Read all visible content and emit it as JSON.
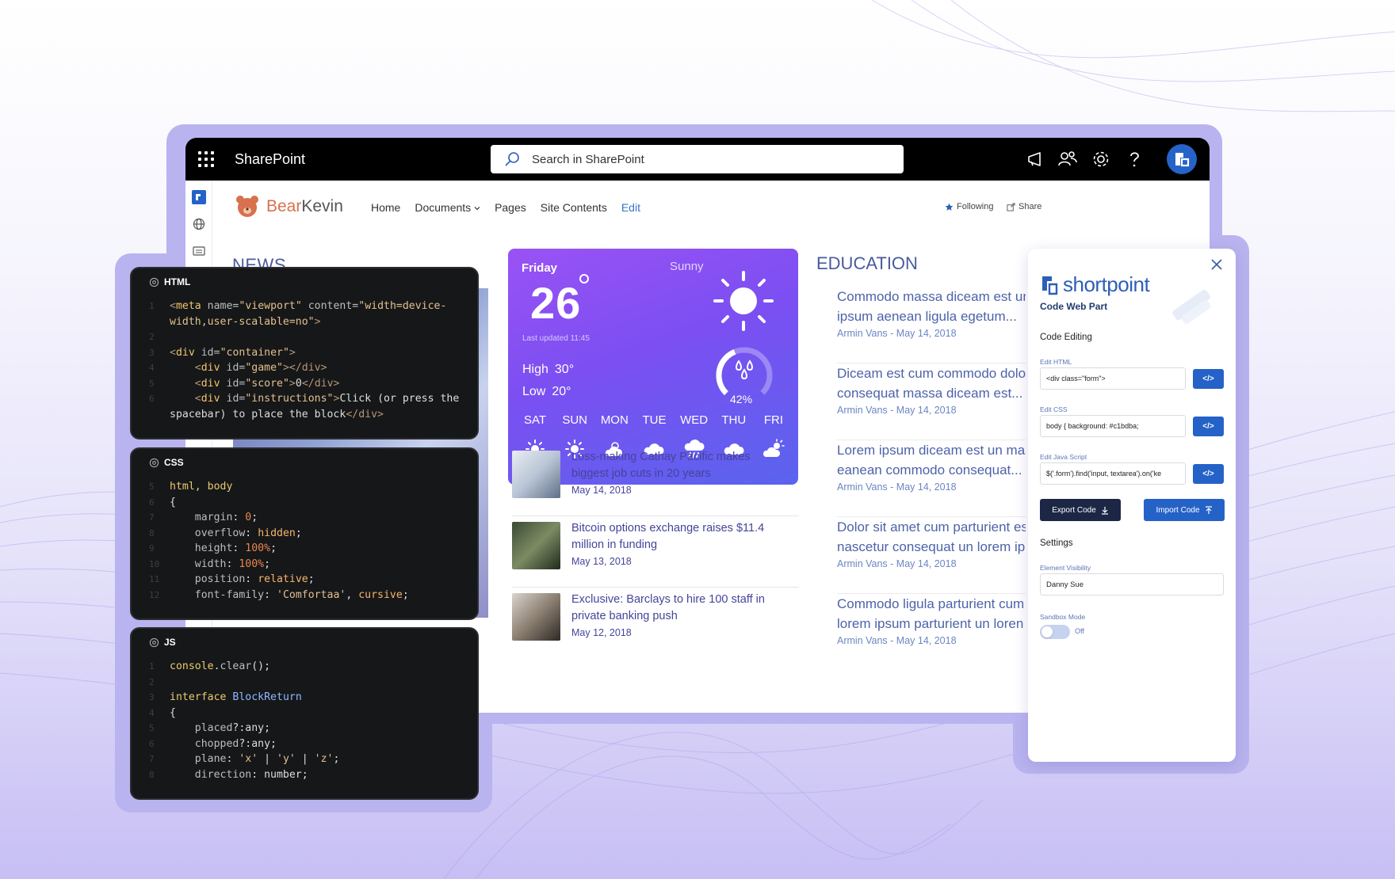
{
  "colors": {
    "accent": "#2562c7",
    "topbar": "#000000",
    "weather_start": "#9a52f4",
    "weather_end": "#5a64ee",
    "code_bg": "#161719",
    "frame": "#b9b3ef"
  },
  "sharepoint": {
    "app_name": "SharePoint",
    "search_placeholder": "Search in SharePoint",
    "icons": [
      "waffle-icon",
      "megaphone-icon",
      "people-icon",
      "gear-icon",
      "help-icon",
      "avatar-icon"
    ]
  },
  "site": {
    "name_part1": "Bear",
    "name_part2": "Kevin",
    "nav": [
      "Home",
      "Documents",
      "Pages",
      "Site Contents",
      "Edit"
    ],
    "following": "Following",
    "share": "Share"
  },
  "news": {
    "title": "NEWS",
    "partial_date": "May 13, 2018"
  },
  "weather": {
    "day": "Friday",
    "condition": "Sunny",
    "temp": "26",
    "last_updated": "Last updated 11:45",
    "high_label": "High",
    "high": "30°",
    "low_label": "Low",
    "low": "20°",
    "humidity": "42%",
    "humidity_fraction": 0.42,
    "days": [
      "SAT",
      "SUN",
      "MON",
      "TUE",
      "WED",
      "THU",
      "FRI"
    ],
    "day_icons": [
      "sun-icon",
      "sun-icon",
      "partly-cloudy-icon",
      "cloud-icon",
      "rain-icon",
      "cloud-icon",
      "partly-sunny-icon"
    ]
  },
  "articles": [
    {
      "title": "Loss-making Cathay Pacific makes biggest job cuts in 20 years",
      "date": "May 14, 2018"
    },
    {
      "title": "Bitcoin options exchange raises $11.4 million in funding",
      "date": "May 13, 2018"
    },
    {
      "title": "Exclusive: Barclays to hire 100 staff in private banking push",
      "date": "May 12, 2018"
    }
  ],
  "education": {
    "title": "EDUCATION",
    "items": [
      {
        "line1": "Commodo massa diceam est un",
        "line2": "ipsum aenean ligula egetum...",
        "meta": "Armin Vans - May 14, 2018"
      },
      {
        "line1": "Diceam est cum commodo dolo",
        "line2": "consequat massa diceam est...",
        "meta": "Armin Vans - May 14, 2018"
      },
      {
        "line1": "Lorem ipsum diceam est un mas",
        "line2": "eanean commodo consequat...",
        "meta": "Armin Vans - May 14, 2018"
      },
      {
        "line1": "Dolor sit amet cum parturient es",
        "line2": "nascetur consequat un lorem ip",
        "meta": "Armin Vans - May 14, 2018"
      },
      {
        "line1": "Commodo ligula parturient cum",
        "line2": "lorem ipsum parturient un loren",
        "meta": "Armin Vans - May 14, 2018"
      }
    ]
  },
  "code_html": {
    "label": "HTML"
  },
  "code_css": {
    "label": "CSS"
  },
  "code_js": {
    "label": "JS"
  },
  "panel": {
    "brand": "shortpoint",
    "subtitle": "Code Web Part",
    "section_code": "Code Editing",
    "html_label": "Edit HTML",
    "html_value": "<div class=\"form\">",
    "css_label": "Edit CSS",
    "css_value": "body {    background: #c1bdba;",
    "js_label": "Edit Java Script",
    "js_value": "$('.form').find('input, textarea').on('ke",
    "code_btn": "</>",
    "export": "Export Code",
    "import": "Import Code",
    "section_settings": "Settings",
    "visibility_label": "Element Visibility",
    "visibility_value": "Danny Sue",
    "sandbox_label": "Sandbox Mode",
    "sandbox_state": "Off"
  }
}
